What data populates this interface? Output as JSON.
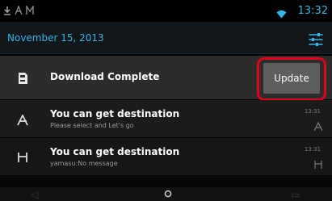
{
  "status_bar": {
    "left_icons": [
      "download-icon",
      "route-icon",
      "m-icon"
    ],
    "time": "13:32",
    "accent_color": "#33b5e5"
  },
  "header": {
    "date": "November 15, 2013"
  },
  "notifications": [
    {
      "title": "Download Complete",
      "action_label": "Update",
      "icon": "sd-card-icon"
    },
    {
      "title": "You can get destination",
      "subtitle": "Please select and Let's go",
      "time": "13:31",
      "icon": "route-icon"
    },
    {
      "title": "You can get destination",
      "subtitle": "yamasu:No message",
      "time": "13:31",
      "icon": "m-icon"
    }
  ],
  "highlight_color": "#e0001b"
}
